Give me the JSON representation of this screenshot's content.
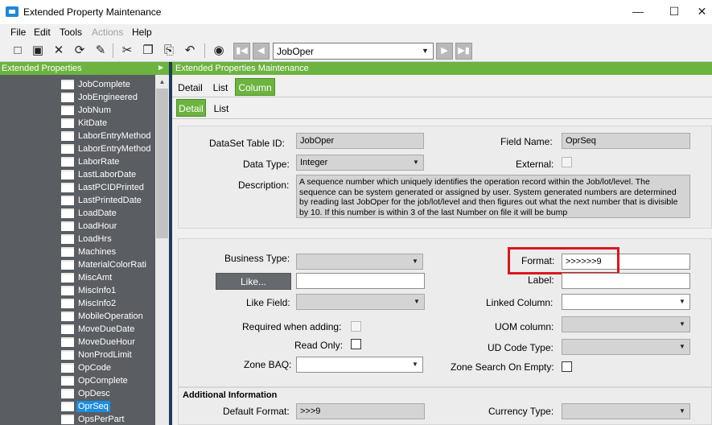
{
  "window": {
    "title": "Extended Property Maintenance",
    "min_glyph": "—",
    "max_glyph": "☐",
    "close_glyph": "✕"
  },
  "menu": [
    "File",
    "Edit",
    "Tools",
    "Actions",
    "Help"
  ],
  "toolbar": {
    "icons": [
      "new-icon",
      "save-icon",
      "delete-icon",
      "refresh-icon",
      "clear-icon",
      "cut-icon",
      "copy-icon",
      "paste-icon",
      "undo-icon",
      "binoculars-icon",
      "first-icon",
      "previous-icon",
      "next-icon",
      "last-icon"
    ],
    "dataset_value": "JobOper"
  },
  "left_panel": {
    "title": "Extended Properties",
    "items": [
      "JobComplete",
      "JobEngineered",
      "JobNum",
      "KitDate",
      "LaborEntryMethod",
      "LaborEntryMethod",
      "LaborRate",
      "LastLaborDate",
      "LastPCIDPrinted",
      "LastPrintedDate",
      "LoadDate",
      "LoadHour",
      "LoadHrs",
      "Machines",
      "MaterialColorRati",
      "MiscAmt",
      "MiscInfo1",
      "MiscInfo2",
      "MobileOperation",
      "MoveDueDate",
      "MoveDueHour",
      "NonProdLimit",
      "OpCode",
      "OpComplete",
      "OpDesc",
      "OprSeq",
      "OpsPerPart"
    ],
    "selected": "OprSeq"
  },
  "right_panel": {
    "title": "Extended Properties Maintenance",
    "tabs": [
      "Detail",
      "List",
      "Column"
    ],
    "subtabs": [
      "Detail",
      "List"
    ],
    "dataset_table_label": "DataSet Table ID:",
    "dataset_table_value": "JobOper",
    "field_name_label": "Field Name:",
    "field_name_value": "OprSeq",
    "data_type_label": "Data Type:",
    "data_type_value": "Integer",
    "external_label": "External:",
    "description_label": "Description:",
    "description_value": "A sequence number which uniquely identifies the operation record within the Job/lot/level. The sequence can be system generated or assigned by user. System generated numbers are determined by reading last JobOper for the job/lot/level and then figures out what the next number that is divisible by 10. If this number is within 3 of the last Number on file it will be bump",
    "business_type_label": "Business Type:",
    "format_label": "Format:",
    "format_value": ">>>>>>9",
    "like_button": "Like...",
    "label_label": "Label:",
    "like_field_label": "Like Field:",
    "linked_column_label": "Linked Column:",
    "required_label": "Required when adding:",
    "uom_label": "UOM column:",
    "read_only_label": "Read Only:",
    "ud_code_label": "UD Code Type:",
    "zone_baq_label": "Zone BAQ:",
    "zone_search_label": "Zone Search On Empty:",
    "additional_info_title": "Additional Information",
    "default_format_label": "Default Format:",
    "default_format_value": ">>>9",
    "currency_type_label": "Currency Type:"
  },
  "colors": {
    "accent_green": "#6cb33f",
    "highlight_red": "#d8181e",
    "selection_blue": "#1c8dde"
  }
}
